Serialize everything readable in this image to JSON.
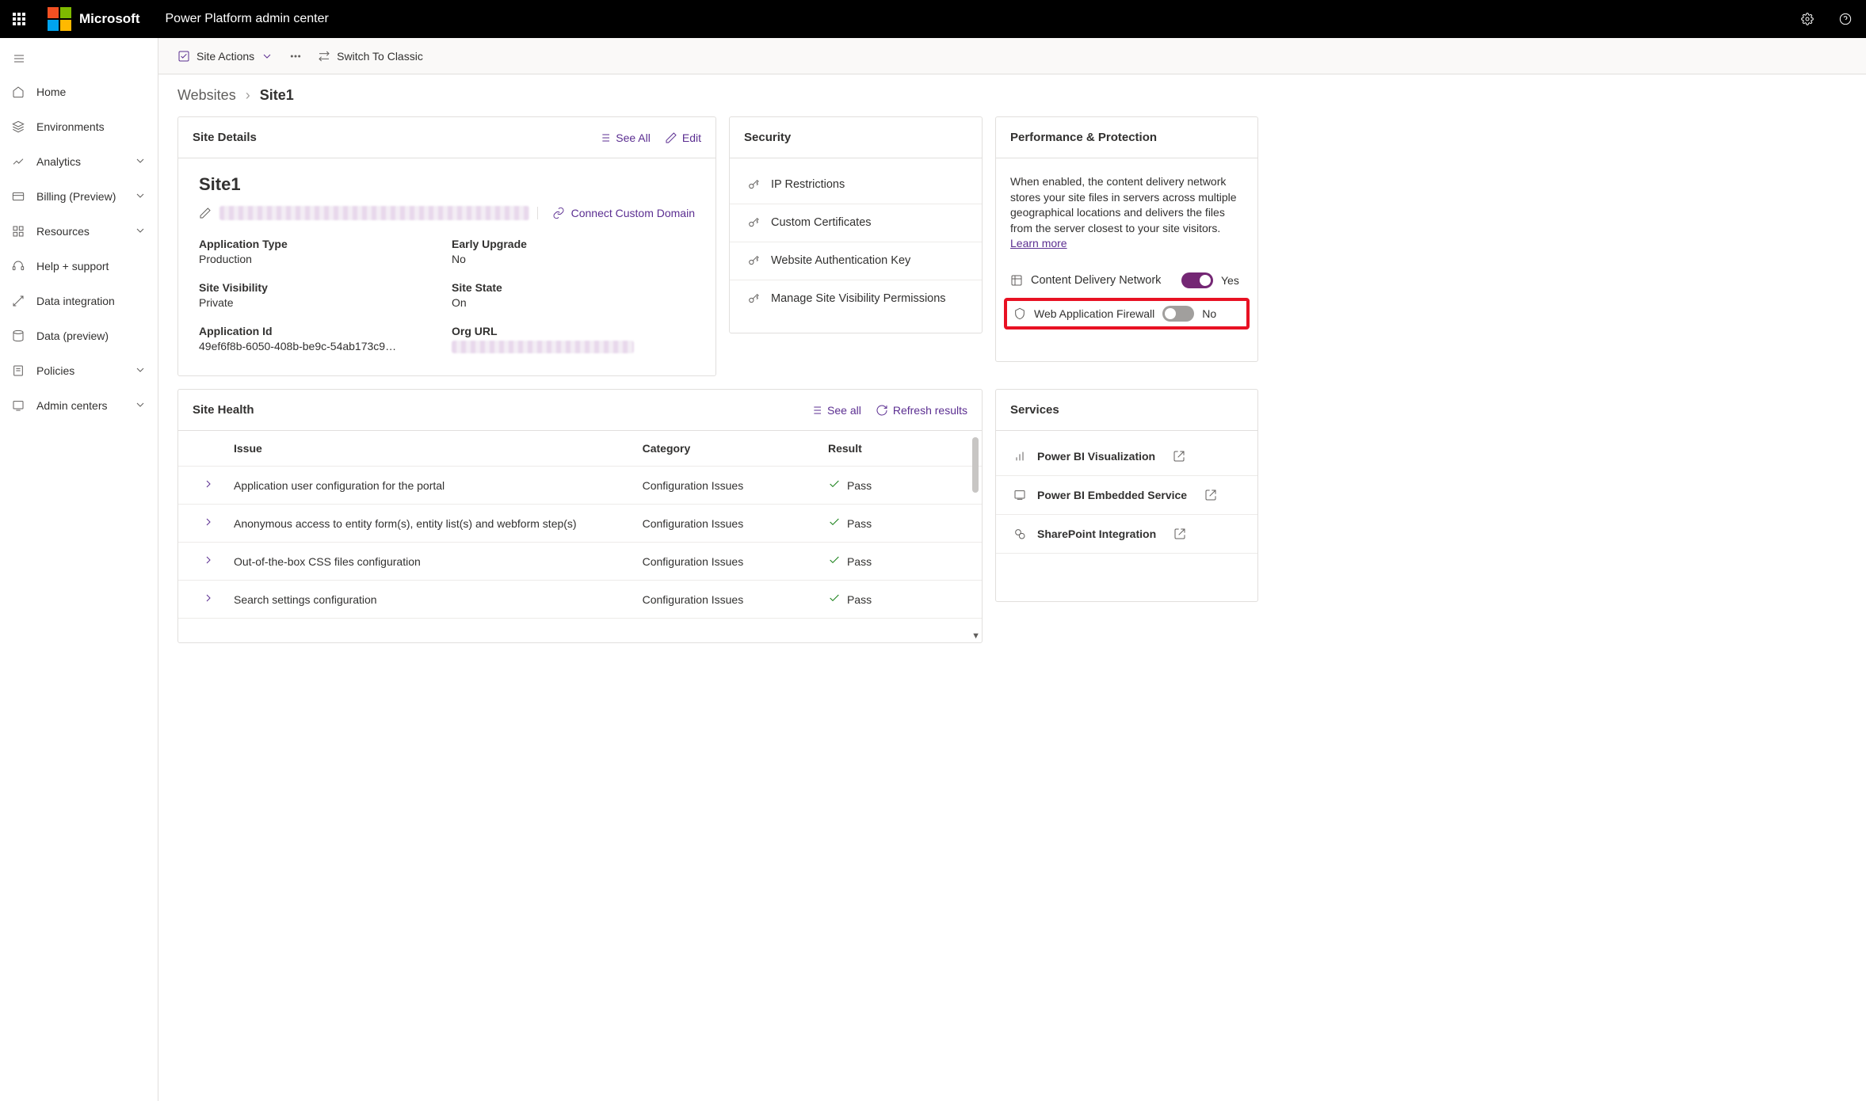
{
  "header": {
    "brand": "Microsoft",
    "app_title": "Power Platform admin center"
  },
  "sidebar": {
    "items": [
      {
        "label": "Home",
        "expandable": false
      },
      {
        "label": "Environments",
        "expandable": false
      },
      {
        "label": "Analytics",
        "expandable": true
      },
      {
        "label": "Billing (Preview)",
        "expandable": true
      },
      {
        "label": "Resources",
        "expandable": true
      },
      {
        "label": "Help + support",
        "expandable": false
      },
      {
        "label": "Data integration",
        "expandable": false
      },
      {
        "label": "Data (preview)",
        "expandable": false
      },
      {
        "label": "Policies",
        "expandable": true
      },
      {
        "label": "Admin centers",
        "expandable": true
      }
    ]
  },
  "commandbar": {
    "site_actions": "Site Actions",
    "switch": "Switch To Classic"
  },
  "breadcrumb": {
    "root": "Websites",
    "current": "Site1"
  },
  "site_details": {
    "header": "Site Details",
    "see_all": "See All",
    "edit": "Edit",
    "title": "Site1",
    "connect_domain": "Connect Custom Domain",
    "fields": {
      "app_type_label": "Application Type",
      "app_type_value": "Production",
      "early_upgrade_label": "Early Upgrade",
      "early_upgrade_value": "No",
      "visibility_label": "Site Visibility",
      "visibility_value": "Private",
      "state_label": "Site State",
      "state_value": "On",
      "app_id_label": "Application Id",
      "app_id_value": "49ef6f8b-6050-408b-be9c-54ab173c9…",
      "org_url_label": "Org URL"
    }
  },
  "security": {
    "header": "Security",
    "items": [
      "IP Restrictions",
      "Custom Certificates",
      "Website Authentication Key",
      "Manage Site Visibility Permissions"
    ]
  },
  "perf": {
    "header": "Performance & Protection",
    "desc": "When enabled, the content delivery network stores your site files in servers across multiple geographical locations and delivers the files from the server closest to your site visitors. ",
    "learn_more": "Learn more",
    "cdn_label": "Content Delivery Network",
    "cdn_state": "Yes",
    "waf_label": "Web Application Firewall",
    "waf_state": "No"
  },
  "health": {
    "header": "Site Health",
    "see_all": "See all",
    "refresh": "Refresh results",
    "col_issue": "Issue",
    "col_category": "Category",
    "col_result": "Result",
    "rows": [
      {
        "issue": "Application user configuration for the portal",
        "category": "Configuration Issues",
        "result": "Pass"
      },
      {
        "issue": "Anonymous access to entity form(s), entity list(s) and webform step(s)",
        "category": "Configuration Issues",
        "result": "Pass"
      },
      {
        "issue": "Out-of-the-box CSS files configuration",
        "category": "Configuration Issues",
        "result": "Pass"
      },
      {
        "issue": "Search settings configuration",
        "category": "Configuration Issues",
        "result": "Pass"
      }
    ]
  },
  "services": {
    "header": "Services",
    "items": [
      "Power BI Visualization",
      "Power BI Embedded Service",
      "SharePoint Integration"
    ]
  }
}
